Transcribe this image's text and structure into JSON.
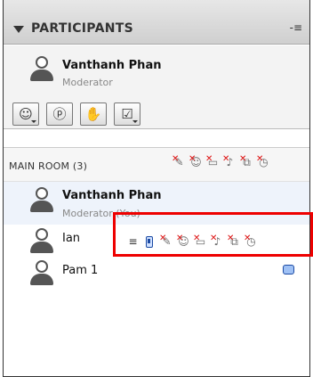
{
  "panel": {
    "title": "PARTICIPANTS",
    "menu_icon": "list-menu-icon"
  },
  "moderator_card": {
    "name": "Vanthanh Phan",
    "role": "Moderator",
    "tools": [
      {
        "icon": "smiley-icon",
        "glyph": "☺"
      },
      {
        "icon": "profile-icon",
        "glyph": "ⓟ"
      },
      {
        "icon": "raise-hand-icon",
        "glyph": "✋"
      },
      {
        "icon": "checkbox-icon",
        "glyph": "☑"
      }
    ]
  },
  "main_room": {
    "label": "MAIN ROOM (3)",
    "participants": [
      {
        "name": "Vanthanh Phan",
        "role": "Moderator (You)"
      },
      {
        "name": "Ian"
      },
      {
        "name": "Pam 1"
      }
    ]
  },
  "colors": {
    "highlight_border": "#e00000",
    "selected_row": "#eef3fb",
    "status_blue": "#1b4aa3"
  }
}
